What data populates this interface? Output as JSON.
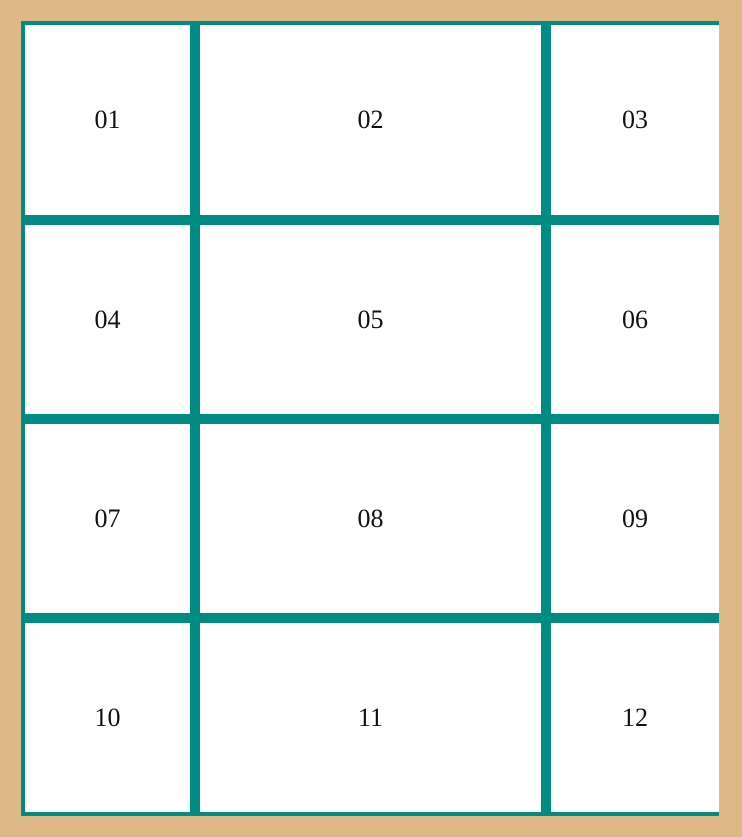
{
  "colors": {
    "background": "#DEB887",
    "grid_line": "#008B83",
    "cell_fill": "#FFFFFF",
    "text": "#111111"
  },
  "grid": {
    "cells": [
      {
        "label": "01"
      },
      {
        "label": "02"
      },
      {
        "label": "03"
      },
      {
        "label": "04"
      },
      {
        "label": "05"
      },
      {
        "label": "06"
      },
      {
        "label": "07"
      },
      {
        "label": "08"
      },
      {
        "label": "09"
      },
      {
        "label": "10"
      },
      {
        "label": "11"
      },
      {
        "label": "12"
      }
    ]
  }
}
